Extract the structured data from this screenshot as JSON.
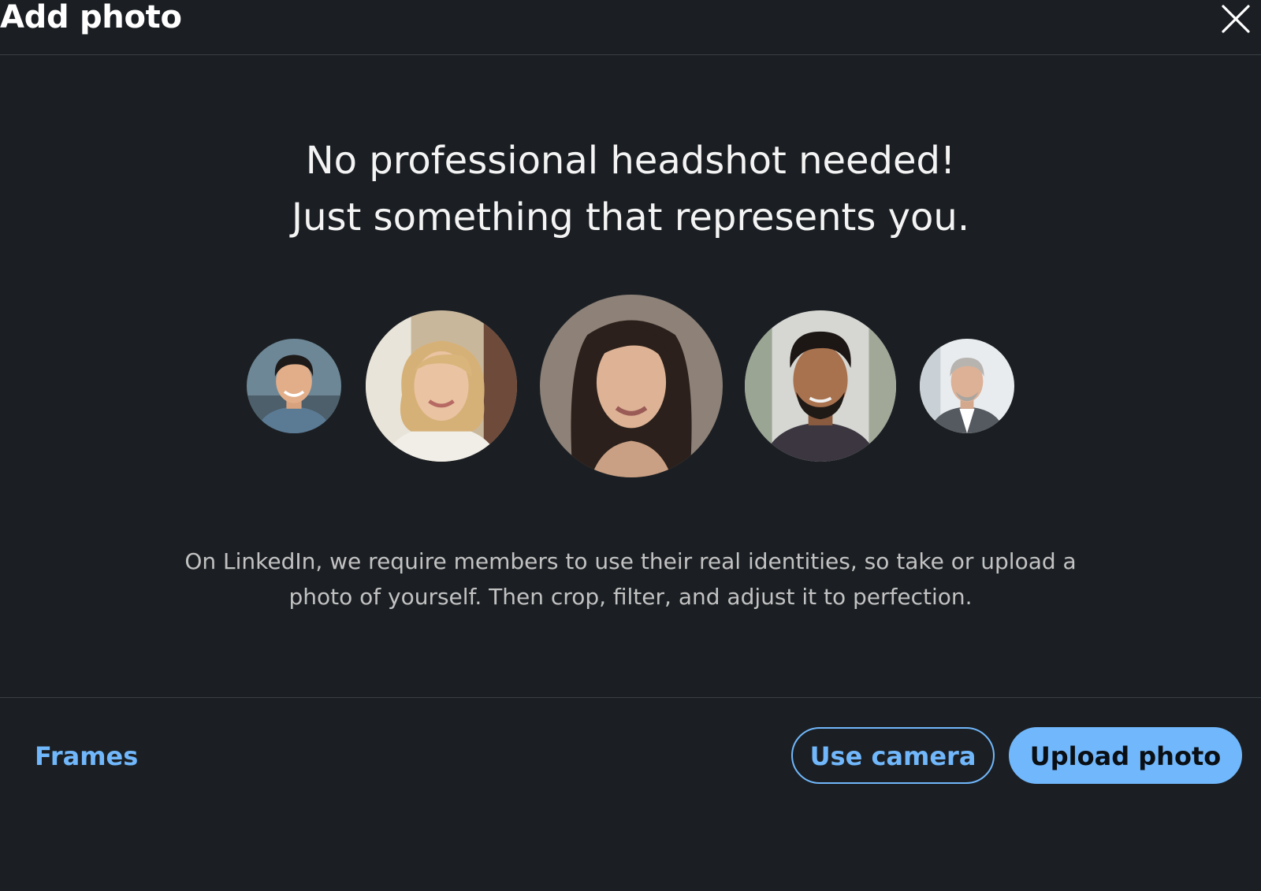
{
  "dialog": {
    "title": "Add photo",
    "close_icon": "close-icon"
  },
  "headline": {
    "line1": "No professional headshot needed!",
    "line2": "Just something that represents you."
  },
  "avatars": [
    {
      "icon": "avatar-photo"
    },
    {
      "icon": "avatar-photo"
    },
    {
      "icon": "avatar-photo"
    },
    {
      "icon": "avatar-photo"
    },
    {
      "icon": "avatar-photo"
    }
  ],
  "description": {
    "line1": "On LinkedIn, we require members to use their real identities, so take or upload a",
    "line2": "photo of yourself. Then crop, filter, and adjust it to perfection."
  },
  "footer": {
    "frames_label": "Frames",
    "camera_label": "Use camera",
    "upload_label": "Upload photo"
  },
  "colors": {
    "background": "#1b1f23",
    "accent": "#71b7fb",
    "divider": "#3a3f44"
  }
}
